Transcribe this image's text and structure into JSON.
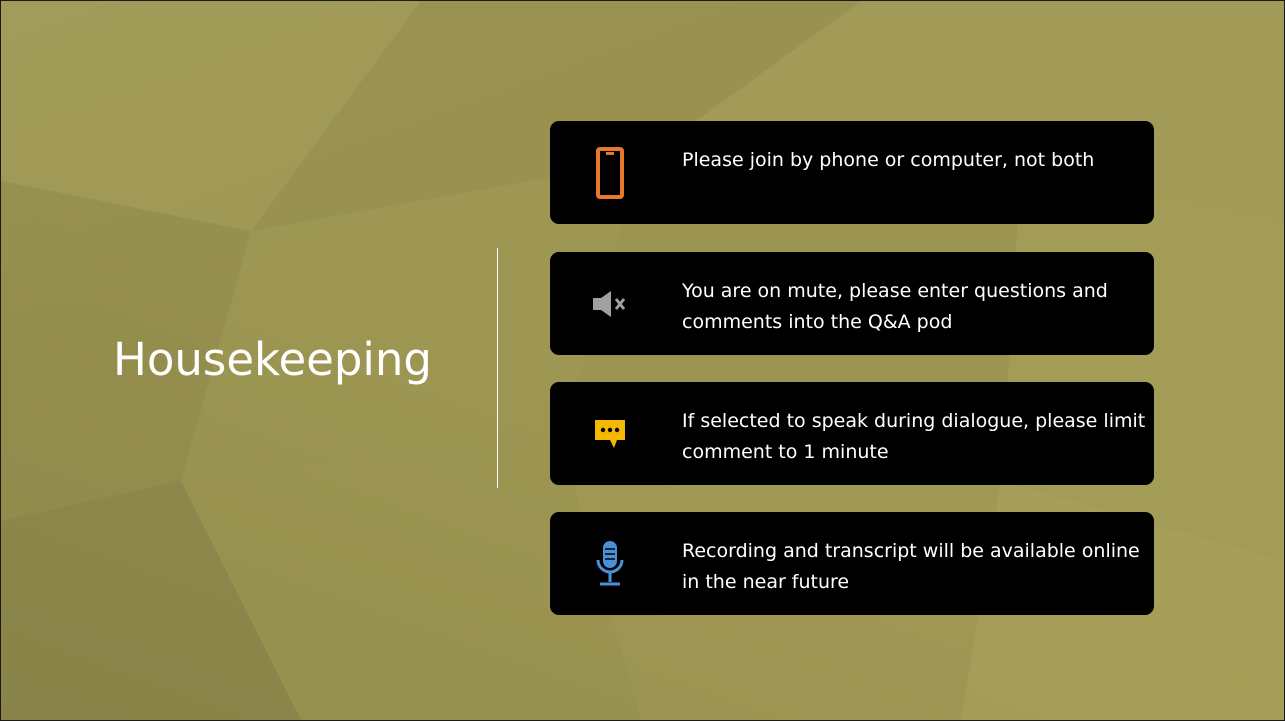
{
  "slide": {
    "title": "Housekeeping",
    "items": [
      {
        "icon": "mobile-phone-icon",
        "text": "Please join by phone or computer, not both"
      },
      {
        "icon": "speaker-muted-icon",
        "text": "You are on mute, please enter questions and comments into the Q&A pod"
      },
      {
        "icon": "chat-bubble-icon",
        "text": "If selected to speak during dialogue, please limit comment to 1 minute"
      },
      {
        "icon": "microphone-icon",
        "text": "Recording and transcript will be available online in the near future"
      }
    ]
  },
  "colors": {
    "background": "#9c9552",
    "card": "#000000",
    "phone_icon": "#e8792b",
    "mute_icon": "#a0a0a0",
    "chat_icon": "#f5b800",
    "mic_icon": "#4a90d9"
  }
}
